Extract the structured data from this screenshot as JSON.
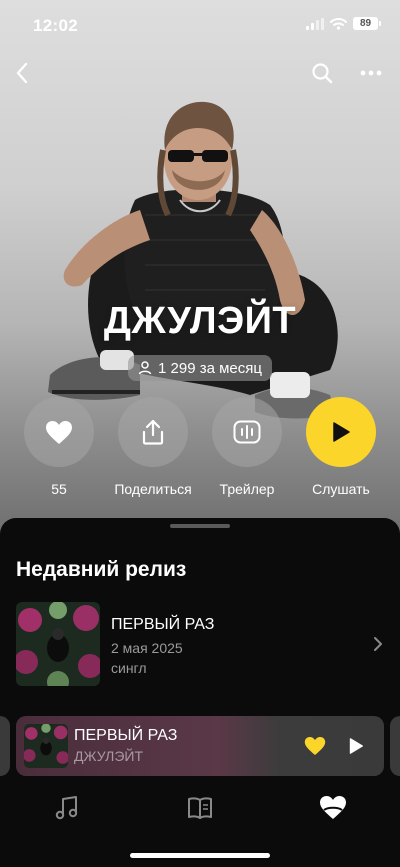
{
  "status_bar": {
    "time": "12:02",
    "battery": "89"
  },
  "artist": {
    "name": "ДЖУЛЭЙТ",
    "listeners": "1 299 за месяц"
  },
  "actions": [
    {
      "label": "55",
      "icon": "heart-icon"
    },
    {
      "label": "Поделиться",
      "icon": "share-icon"
    },
    {
      "label": "Трейлер",
      "icon": "trailer-icon"
    },
    {
      "label": "Слушать",
      "icon": "play-icon"
    }
  ],
  "recent_release": {
    "section_title": "Недавний релиз",
    "title": "ПЕРВЫЙ РАЗ",
    "date": "2 мая 2025",
    "type": "сингл"
  },
  "mini_player": {
    "title": "ПЕРВЫЙ РАЗ",
    "artist": "ДЖУЛЭЙТ"
  },
  "tabs": [
    {
      "icon": "music-note-icon"
    },
    {
      "icon": "book-icon"
    },
    {
      "icon": "heart-wave-icon"
    }
  ],
  "colors": {
    "accent": "#fcd52b",
    "sheet_bg": "#0b0b0b",
    "secondary_text": "#9a9a9a"
  }
}
